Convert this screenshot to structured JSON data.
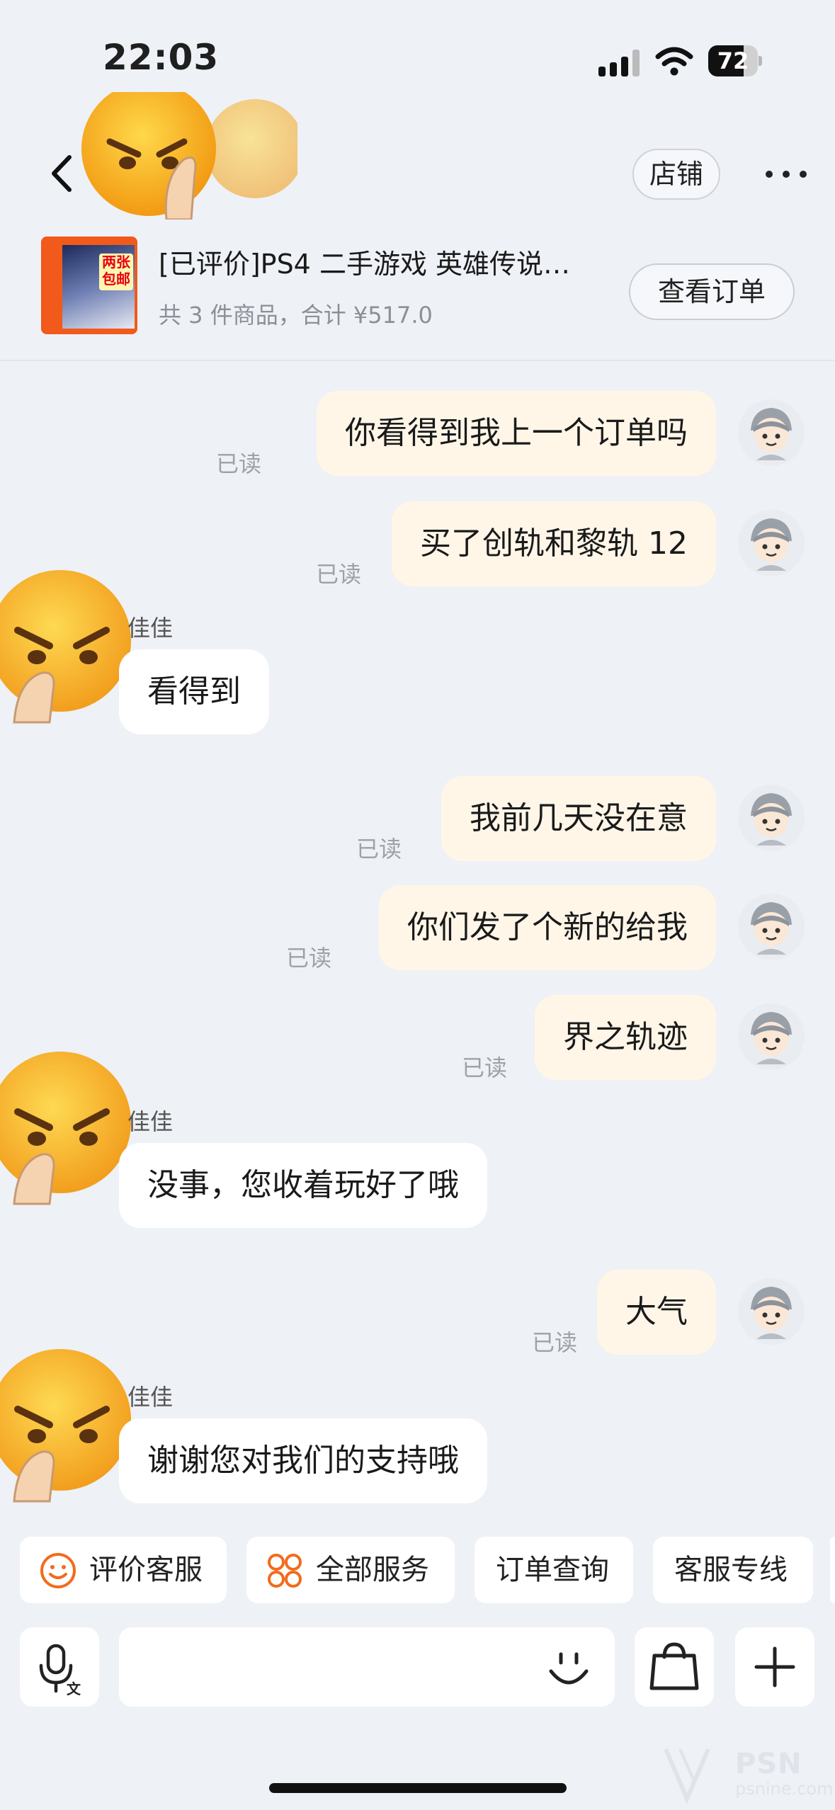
{
  "status_bar": {
    "time": "22:03",
    "battery": "72",
    "battery_level": 0.72
  },
  "header": {
    "store_label": "店铺"
  },
  "order": {
    "title": "[已评价]PS4 二手游戏 英雄传说…",
    "summary": "共 3 件商品，合计 ¥517.0",
    "view_order_label": "查看订单",
    "thumb_badge": "两张包邮"
  },
  "messages": [
    {
      "direction": "out",
      "text": "你看得到我上一个订单吗",
      "receipt": "已读"
    },
    {
      "direction": "out",
      "text": "买了创轨和黎轨 12",
      "receipt": "已读"
    },
    {
      "direction": "in",
      "sender": "佳佳",
      "text": "看得到"
    },
    {
      "direction": "out",
      "text": "我前几天没在意",
      "receipt": "已读"
    },
    {
      "direction": "out",
      "text": "你们发了个新的给我",
      "receipt": "已读"
    },
    {
      "direction": "out",
      "text": "界之轨迹",
      "receipt": "已读"
    },
    {
      "direction": "in",
      "sender": "佳佳",
      "text": "没事，您收着玩好了哦"
    },
    {
      "direction": "out",
      "text": "大气",
      "receipt": "已读"
    },
    {
      "direction": "in",
      "sender": "佳佳",
      "text": "谢谢您对我们的支持哦"
    }
  ],
  "quick_actions": [
    {
      "label": "评价客服",
      "icon": "smile-icon"
    },
    {
      "label": "全部服务",
      "icon": "grid-icon"
    },
    {
      "label": "订单查询",
      "icon": ""
    },
    {
      "label": "客服专线",
      "icon": ""
    }
  ],
  "input": {
    "placeholder": ""
  },
  "watermark": {
    "brand": "PSN",
    "site": "psnine.com"
  },
  "colors": {
    "outgoing_bubble": "#fff6e8",
    "incoming_bubble": "#ffffff",
    "accent": "#f26b1d",
    "background": "#eef1f6"
  }
}
